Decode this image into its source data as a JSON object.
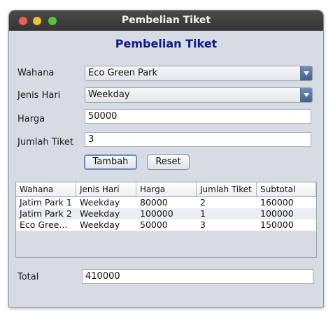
{
  "window": {
    "title": "Pembelian Tiket",
    "controls": {
      "close": "close-icon",
      "minimize": "minimize-icon",
      "maximize": "maximize-icon"
    }
  },
  "form": {
    "heading": "Pembelian Tiket",
    "wahana_label": "Wahana",
    "wahana_value": "Eco Green Park",
    "jenis_hari_label": "Jenis Hari",
    "jenis_hari_value": "Weekday",
    "harga_label": "Harga",
    "harga_value": "50000",
    "jumlah_label": "Jumlah Tiket",
    "jumlah_value": "3",
    "tambah_label": "Tambah",
    "reset_label": "Reset"
  },
  "table": {
    "columns": [
      "Wahana",
      "Jenis Hari",
      "Harga",
      "Jumlah Tiket",
      "Subtotal"
    ],
    "rows": [
      [
        "Jatim Park 1",
        "Weekday",
        "80000",
        "2",
        "160000"
      ],
      [
        "Jatim Park 2",
        "Weekday",
        "100000",
        "1",
        "100000"
      ],
      [
        "Eco Gree...",
        "Weekday",
        "50000",
        "3",
        "150000"
      ]
    ]
  },
  "footer": {
    "total_label": "Total",
    "total_value": "410000"
  },
  "colors": {
    "title_text": "#0d1a8f",
    "window_bg": "#d7dbe3",
    "combo_arrow": "#3e6290"
  }
}
